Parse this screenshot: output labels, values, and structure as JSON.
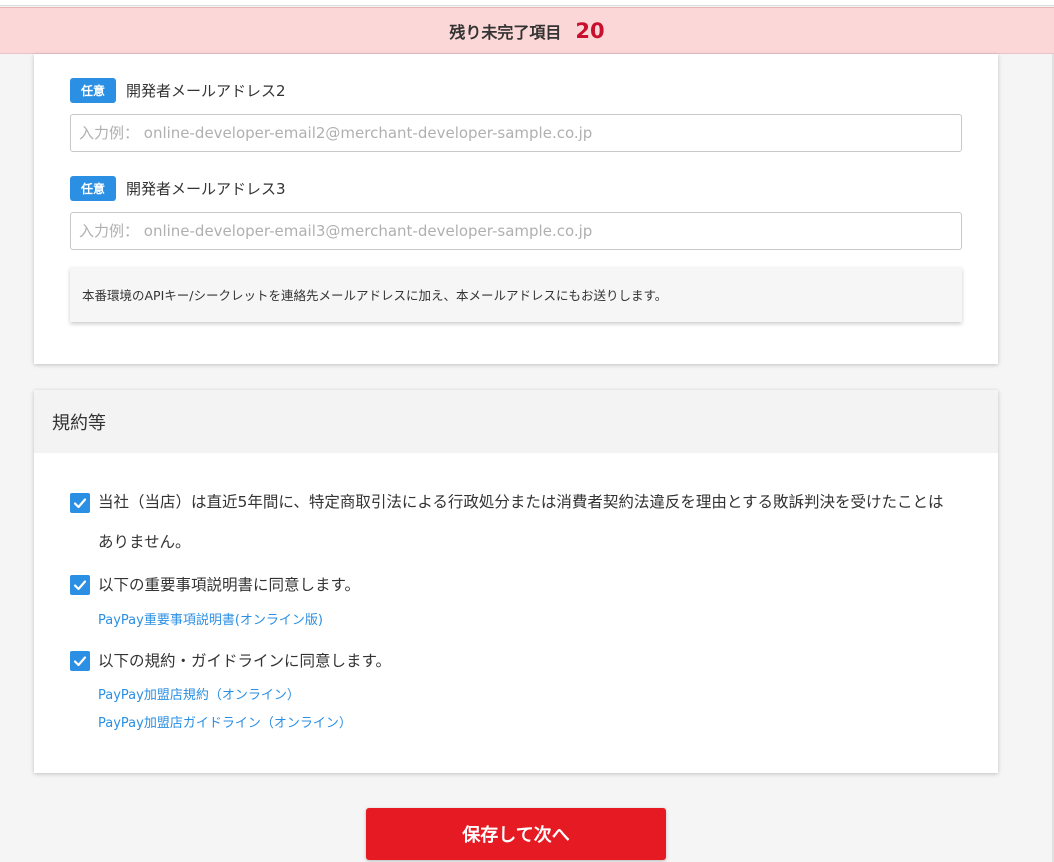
{
  "banner": {
    "label": "残り未完了項目",
    "count": "20"
  },
  "developer_emails": [
    {
      "badge": "任意",
      "label": "開発者メールアドレス2",
      "placeholder": "入力例： online-developer-email2@merchant-developer-sample.co.jp",
      "value": ""
    },
    {
      "badge": "任意",
      "label": "開発者メールアドレス3",
      "placeholder": "入力例： online-developer-email3@merchant-developer-sample.co.jp",
      "value": ""
    }
  ],
  "note": "本番環境のAPIキー/シークレットを連絡先メールアドレスに加え、本メールアドレスにもお送りします。",
  "terms": {
    "title": "規約等",
    "items": [
      {
        "checked": true,
        "text": "当社（当店）は直近5年間に、特定商取引法による行政処分または消費者契約法違反を理由とする敗訴判決を受けたことはありません。"
      },
      {
        "checked": true,
        "text": "以下の重要事項説明書に同意します。",
        "links": [
          "PayPay重要事項説明書(オンライン版)"
        ]
      },
      {
        "checked": true,
        "text": "以下の規約・ガイドラインに同意します。",
        "links": [
          "PayPay加盟店規約（オンライン）",
          "PayPay加盟店ガイドライン（オンライン）"
        ]
      }
    ]
  },
  "save_button": "保存して次へ",
  "colors": {
    "banner_bg": "#fcd7d7",
    "count_red": "#c8102e",
    "accent_blue": "#2b8fe3",
    "button_red": "#e61a22"
  }
}
